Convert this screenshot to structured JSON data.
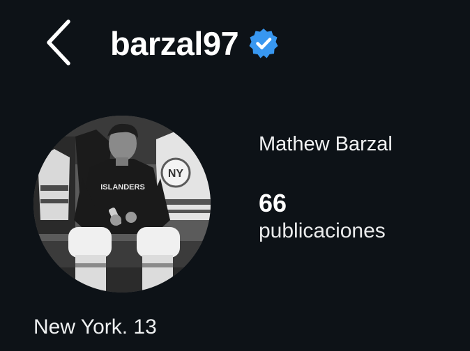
{
  "header": {
    "username": "barzal97",
    "back_icon": "chevron-left-icon",
    "verified_icon": "verified-badge-icon",
    "accent_color": "#3897f0"
  },
  "profile": {
    "full_name": "Mathew Barzal",
    "posts_count": "66",
    "posts_label": "publicaciones",
    "bio": "New York. 13",
    "avatar_jersey_text": "ISLANDERS"
  },
  "colors": {
    "background": "#0d1217",
    "text": "#ffffff"
  }
}
